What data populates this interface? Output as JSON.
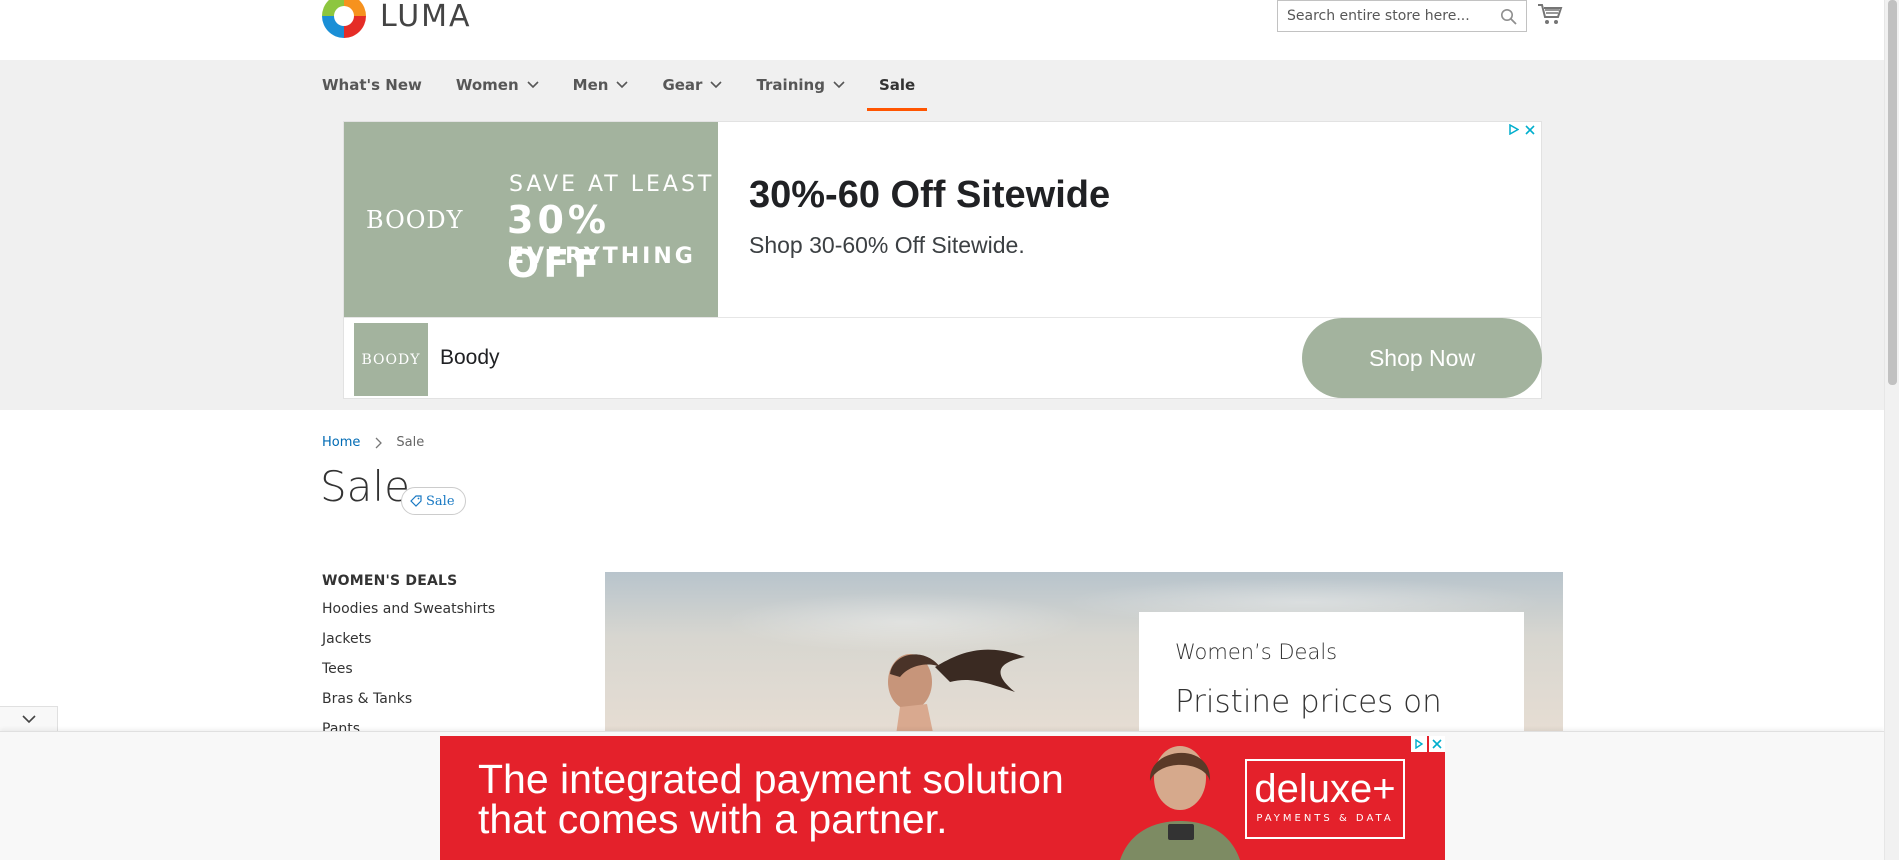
{
  "header": {
    "logo_text": "LUMA",
    "search_placeholder": "Search entire store here..."
  },
  "nav": {
    "items": [
      {
        "label": "What's New",
        "has_dropdown": false
      },
      {
        "label": "Women",
        "has_dropdown": true
      },
      {
        "label": "Men",
        "has_dropdown": true
      },
      {
        "label": "Gear",
        "has_dropdown": true
      },
      {
        "label": "Training",
        "has_dropdown": true
      },
      {
        "label": "Sale",
        "has_dropdown": false,
        "active": true
      }
    ]
  },
  "ad_top": {
    "brand": "BOODY",
    "promo_line1": "SAVE AT LEAST",
    "promo_line2": "30% OFF",
    "promo_line3": "EVERYTHING",
    "headline": "30%-60 Off Sitewide",
    "subhead": "Shop 30-60% Off Sitewide.",
    "thumb_text": "BOODY",
    "advertiser": "Boody",
    "cta": "Shop Now",
    "brand_color": "#a3b39e"
  },
  "breadcrumb": {
    "home": "Home",
    "current": "Sale"
  },
  "page": {
    "title": "Sale",
    "tag": "Sale"
  },
  "sidebar": {
    "heading": "WOMEN'S DEALS",
    "items": [
      "Hoodies and Sweatshirts",
      "Jackets",
      "Tees",
      "Bras & Tanks",
      "Pants"
    ]
  },
  "hero": {
    "subtitle": "Women’s Deals",
    "headline": "Pristine prices on"
  },
  "ad_bottom": {
    "line1": "The integrated payment solution",
    "line2": "that comes with a partner.",
    "brand": "deluxe+",
    "brand_tag": "PAYMENTS & DATA",
    "color": "#e4212b"
  },
  "colors": {
    "accent": "#ff5501",
    "link": "#006bb4"
  }
}
